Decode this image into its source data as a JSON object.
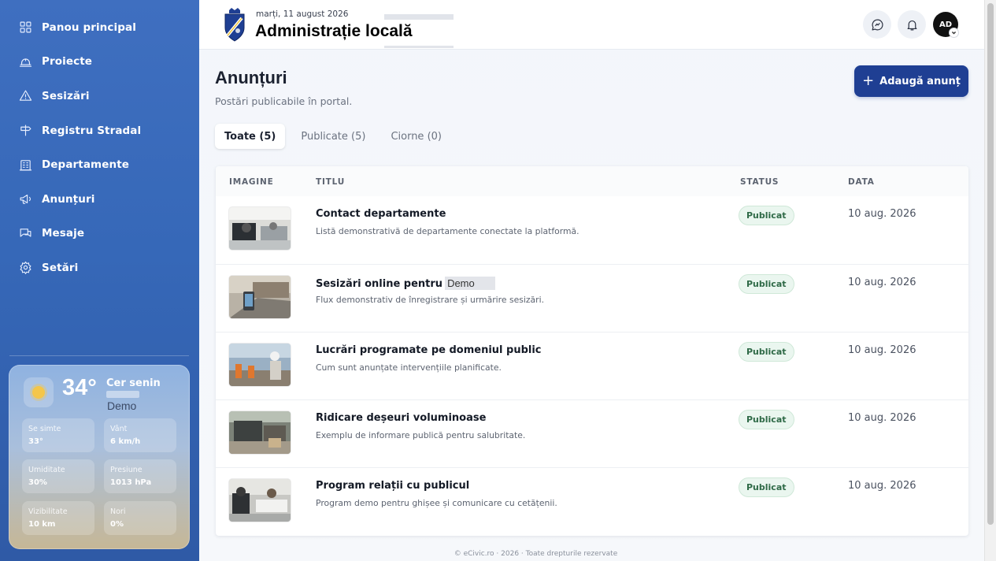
{
  "sidebar": {
    "items": [
      {
        "label": "Panou principal",
        "icon": "dashboard-icon"
      },
      {
        "label": "Proiecte",
        "icon": "projects-icon"
      },
      {
        "label": "Sesizări",
        "icon": "alert-triangle-icon"
      },
      {
        "label": "Registru Stradal",
        "icon": "signpost-icon"
      },
      {
        "label": "Departamente",
        "icon": "building-icon"
      },
      {
        "label": "Anunțuri",
        "icon": "megaphone-icon"
      },
      {
        "label": "Mesaje",
        "icon": "chat-icon"
      },
      {
        "label": "Setări",
        "icon": "gear-icon"
      }
    ]
  },
  "weather": {
    "temp": "34°",
    "condition": "Cer senin",
    "city": "Demo",
    "stats": [
      {
        "label": "Se simte",
        "value": "33°"
      },
      {
        "label": "Vânt",
        "value": "6 km/h"
      },
      {
        "label": "Umiditate",
        "value": "30%"
      },
      {
        "label": "Presiune",
        "value": "1013 hPa"
      },
      {
        "label": "Vizibilitate",
        "value": "10 km"
      },
      {
        "label": "Nori",
        "value": "0%"
      }
    ]
  },
  "header": {
    "date": "marți, 11 august 2026",
    "title": "Administrație locală",
    "avatar_initials": "AD"
  },
  "page": {
    "title": "Anunțuri",
    "subtitle": "Postări publicabile în portal.",
    "add_button": "Adaugă anunț"
  },
  "tabs": [
    {
      "label": "Toate (5)",
      "active": true
    },
    {
      "label": "Publicate (5)",
      "active": false
    },
    {
      "label": "Ciorne (0)",
      "active": false
    }
  ],
  "table": {
    "columns": [
      "IMAGINE",
      "TITLU",
      "STATUS",
      "DATA"
    ],
    "rows": [
      {
        "title": "Contact departamente",
        "desc": "Listă demonstrativă de departamente conectate la platformă.",
        "status": "Publicat",
        "date": "10 aug. 2026"
      },
      {
        "title": "Sesizări online pentru",
        "title_suffix": "Demo",
        "desc": "Flux demonstrativ de înregistrare și urmărire sesizări.",
        "status": "Publicat",
        "date": "10 aug. 2026"
      },
      {
        "title": "Lucrări programate pe domeniul public",
        "desc": "Cum sunt anunțate intervențiile planificate.",
        "status": "Publicat",
        "date": "10 aug. 2026"
      },
      {
        "title": "Ridicare deșeuri voluminoase",
        "desc": "Exemplu de informare publică pentru salubritate.",
        "status": "Publicat",
        "date": "10 aug. 2026"
      },
      {
        "title": "Program relații cu publicul",
        "desc": "Program demo pentru ghișee și comunicare cu cetățenii.",
        "status": "Publicat",
        "date": "10 aug. 2026"
      }
    ]
  },
  "footer": {
    "text": "© eCivic.ro · 2026 · Toate drepturile rezervate"
  },
  "colors": {
    "sidebar": "#3668b8",
    "primary_button": "#1f3f93",
    "badge_bg": "#eaf6ef",
    "badge_text": "#2f6a47"
  }
}
